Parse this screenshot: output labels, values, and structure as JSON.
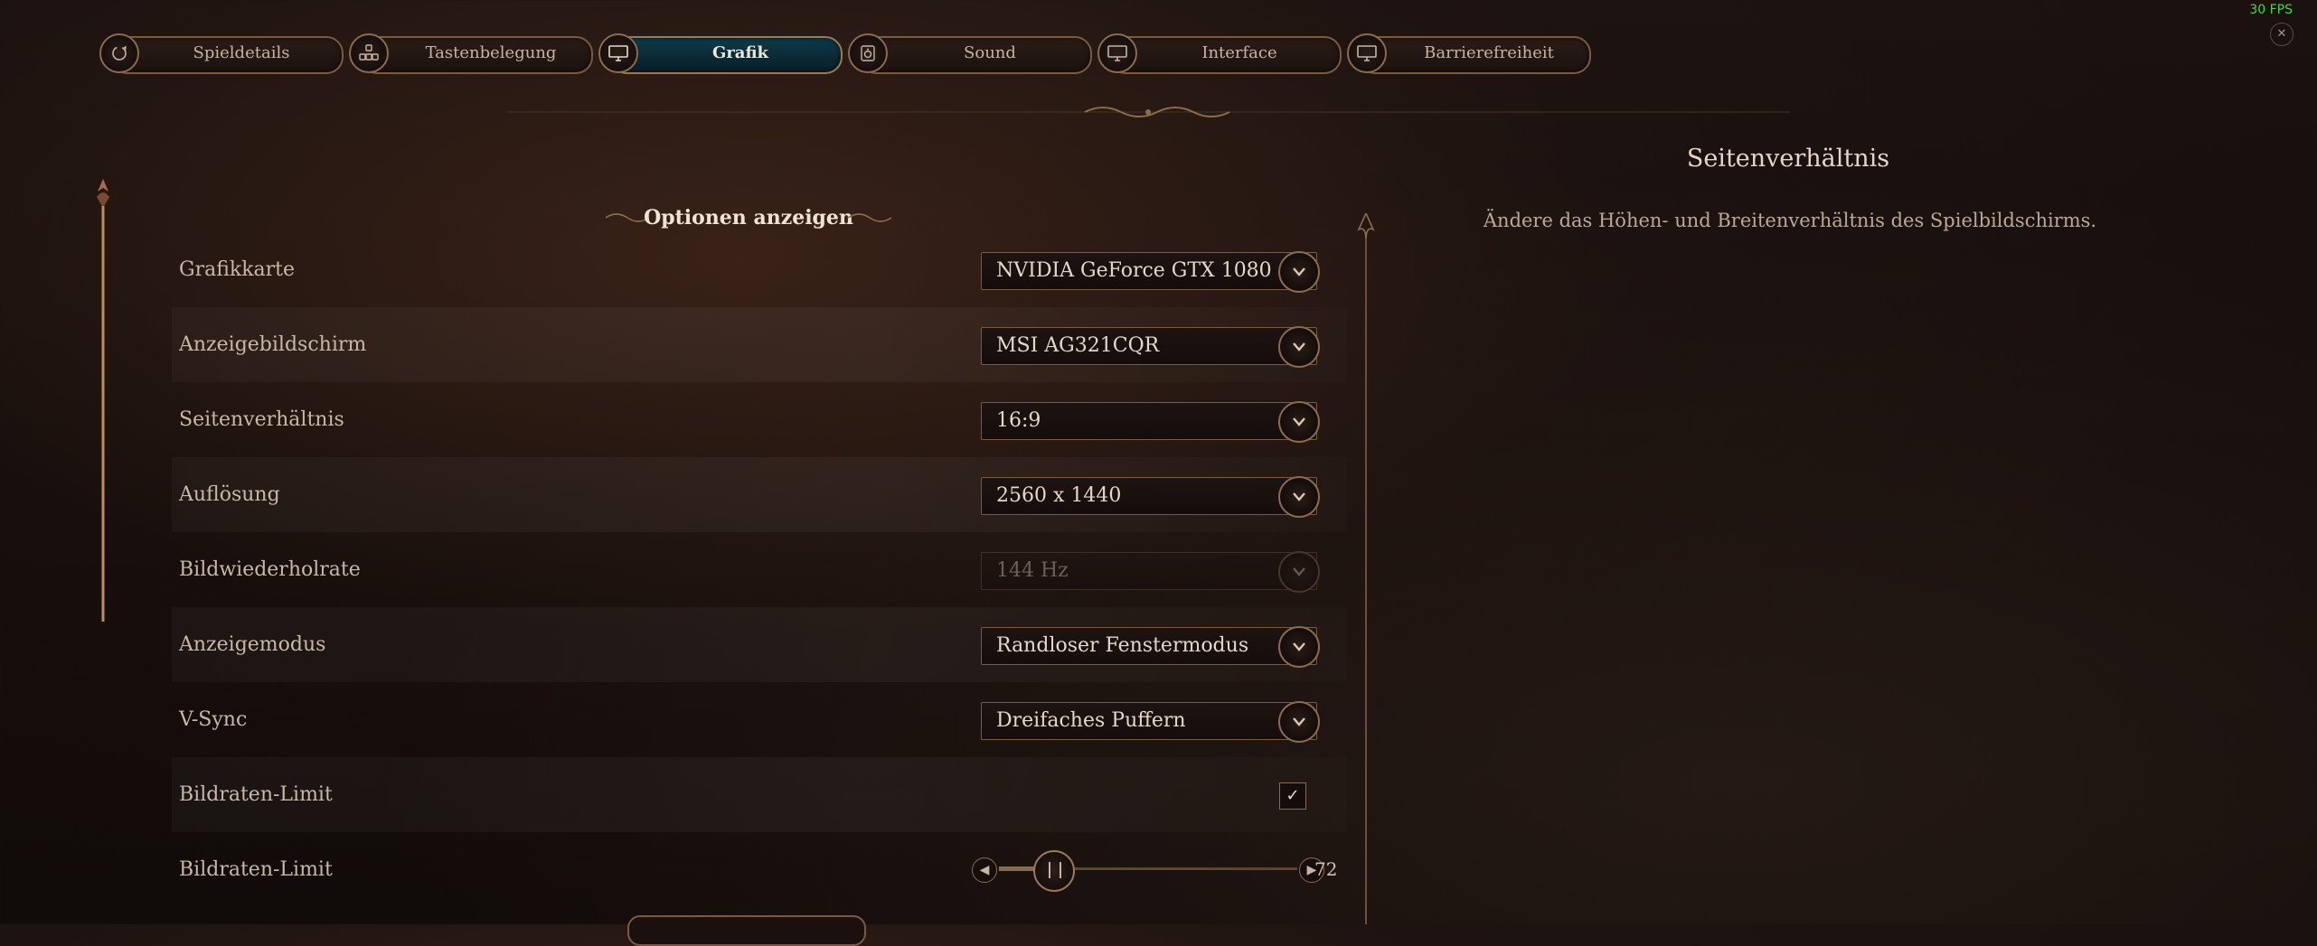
{
  "overlay": {
    "fps": "30 FPS"
  },
  "tabs": [
    {
      "label": "Spieldetails",
      "icon": "refresh-circle-icon"
    },
    {
      "label": "Tastenbelegung",
      "icon": "keys-icon"
    },
    {
      "label": "Grafik",
      "icon": "monitor-icon",
      "active": true
    },
    {
      "label": "Sound",
      "icon": "speaker-icon"
    },
    {
      "label": "Interface",
      "icon": "monitor-icon"
    },
    {
      "label": "Barrierefreiheit",
      "icon": "monitor-icon"
    }
  ],
  "section": {
    "title": "Optionen anzeigen"
  },
  "settings": [
    {
      "label": "Grafikkarte",
      "value": "NVIDIA GeForce GTX 1080"
    },
    {
      "label": "Anzeigebildschirm",
      "value": "MSI AG321CQR"
    },
    {
      "label": "Seitenverhältnis",
      "value": "16:9"
    },
    {
      "label": "Auflösung",
      "value": "2560 x 1440"
    },
    {
      "label": "Bildwiederholrate",
      "value": "144 Hz"
    },
    {
      "label": "Anzeigemodus",
      "value": "Randloser Fenstermodus"
    },
    {
      "label": "V-Sync",
      "value": "Dreifaches Puffern"
    },
    {
      "label": "Bildraten-Limit",
      "value": "✓"
    },
    {
      "label": "Bildraten-Limit",
      "value": "72"
    }
  ],
  "framerate_slider": {
    "level": 0.18
  },
  "description": {
    "title": "Seitenverhältnis",
    "text": "Ändere das Höhen- und Breitenverhältnis des Spielbildschirms."
  },
  "colors": {
    "accent": "#8b6b4c",
    "active_tab": "#0f3b4b",
    "fps": "#3cdc3c"
  }
}
